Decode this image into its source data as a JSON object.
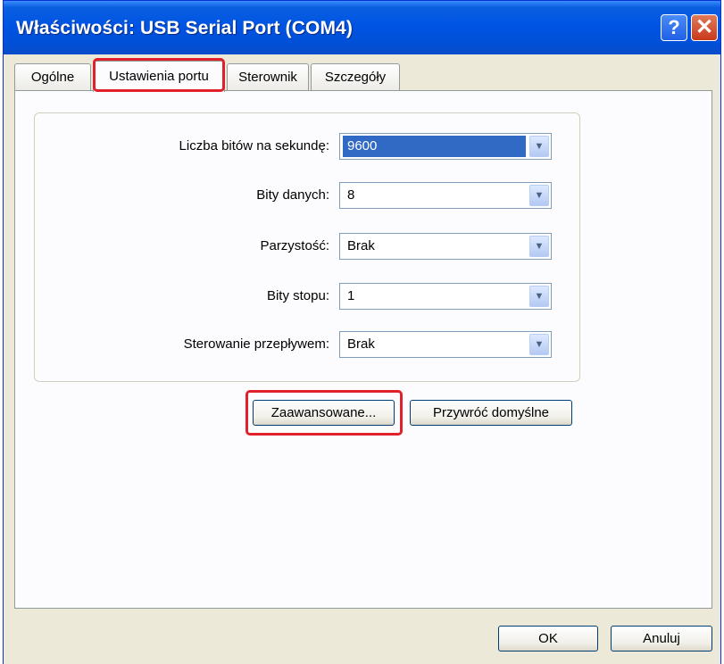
{
  "window": {
    "title": "Właściwości: USB Serial Port (COM4)"
  },
  "titlebar_buttons": {
    "help": "?",
    "close": "✕"
  },
  "tabs": [
    {
      "label": "Ogólne"
    },
    {
      "label": "Ustawienia portu"
    },
    {
      "label": "Sterownik"
    },
    {
      "label": "Szczegóły"
    }
  ],
  "active_tab": "Ustawienia portu",
  "port_settings": {
    "baud_rate": {
      "label": "Liczba bitów na sekundę:",
      "value": "9600"
    },
    "data_bits": {
      "label": "Bity danych:",
      "value": "8"
    },
    "parity": {
      "label": "Parzystość:",
      "value": "Brak"
    },
    "stop_bits": {
      "label": "Bity stopu:",
      "value": "1"
    },
    "flow_control": {
      "label": "Sterowanie przepływem:",
      "value": "Brak"
    }
  },
  "buttons": {
    "advanced": "Zaawansowane...",
    "restore_defaults": "Przywróć domyślne",
    "ok": "OK",
    "cancel": "Anuluj"
  },
  "icons": {
    "dropdown": "chevron-down-icon"
  },
  "colors": {
    "titlebar": "#0054e3",
    "dialog_bg": "#ece9d8",
    "selection": "#316ac5",
    "highlight": "#e0202a"
  }
}
